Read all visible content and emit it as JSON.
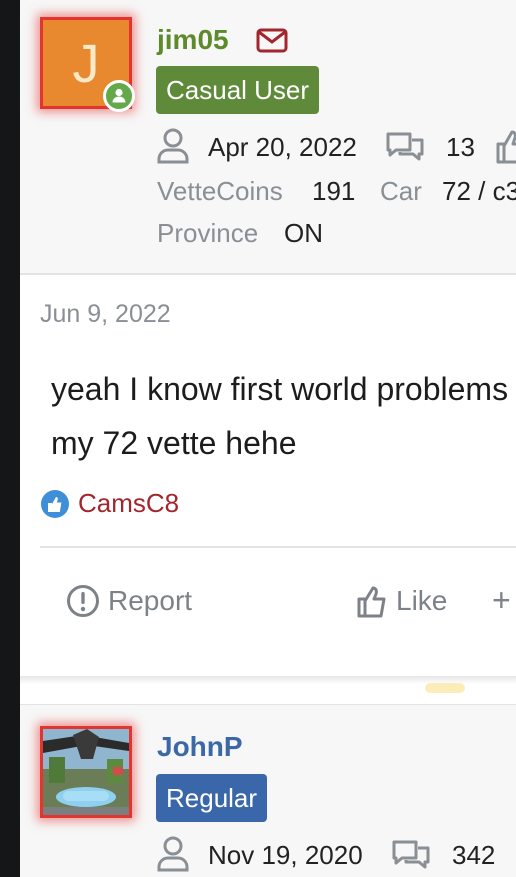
{
  "post_author": {
    "username": "jim05",
    "avatar_letter": "J",
    "rank": "Casual User",
    "joined": "Apr 20, 2022",
    "messages": "13",
    "vettecoins_label": "VetteCoins",
    "vettecoins_value": "191",
    "car_label": "Car",
    "car_value": "72 / c3",
    "province_label": "Province",
    "province_value": "ON",
    "colors": {
      "avatar_bg": "#e8892f",
      "username": "#5d8a2a",
      "rank_bg": "#5f8a3a"
    }
  },
  "post": {
    "date": "Jun 9, 2022",
    "message_line1": "yeah I know first world problems",
    "message_line2": "my 72 vette hehe",
    "reaction_user": "CamsC8"
  },
  "actions": {
    "report": "Report",
    "like": "Like",
    "more": "+"
  },
  "next_author": {
    "username": "JohnP",
    "rank": "Regular",
    "joined": "Nov 19, 2020",
    "messages": "342",
    "colors": {
      "username": "#3b68a6",
      "rank_bg": "#3a67aa"
    }
  }
}
